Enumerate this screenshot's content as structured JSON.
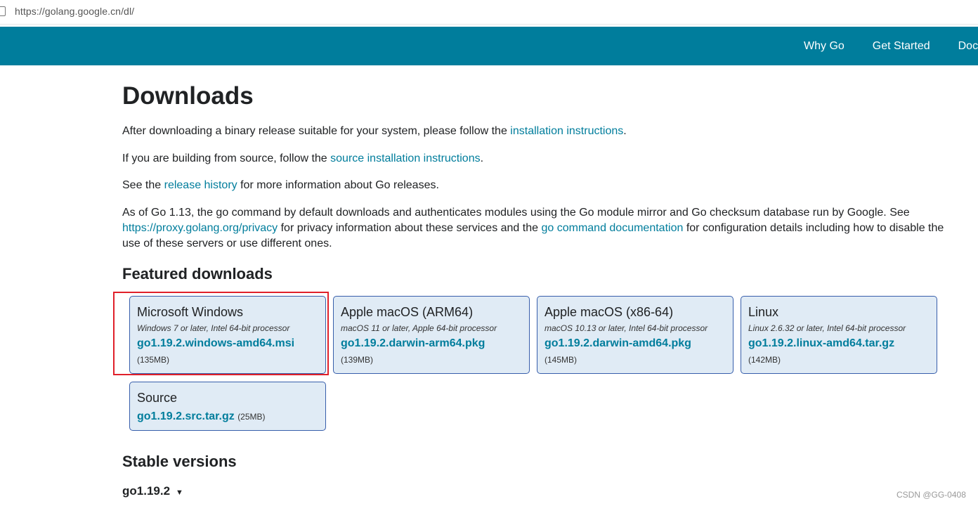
{
  "browser": {
    "url": "https://golang.google.cn/dl/"
  },
  "header": {
    "nav": [
      "Why Go",
      "Get Started",
      "Docs"
    ],
    "color": "#007d9c"
  },
  "page": {
    "title": "Downloads",
    "p1": {
      "before": "After downloading a binary release suitable for your system, please follow the ",
      "link": "installation instructions",
      "after": "."
    },
    "p2": {
      "before": "If you are building from source, follow the ",
      "link": "source installation instructions",
      "after": "."
    },
    "p3": {
      "before": "See the ",
      "link": "release history",
      "after": " for more information about Go releases."
    },
    "p4": {
      "a": "As of Go 1.13, the go command by default downloads and authenticates modules using the Go module mirror and Go checksum database run by Google. See ",
      "link1": "https://proxy.golang.org/privacy",
      "b": " for privacy information about these services and the ",
      "link2": "go command documentation",
      "c": " for configuration details including how to disable the use of these servers or use different ones."
    },
    "featured_heading": "Featured downloads",
    "stable_heading": "Stable versions",
    "stable_version": "go1.19.2",
    "stable_caret": "▼"
  },
  "featured": [
    {
      "os": "Microsoft Windows",
      "req": "Windows 7 or later, Intel 64-bit processor",
      "file": "go1.19.2.windows-amd64.msi",
      "size": "(135MB)"
    },
    {
      "os": "Apple macOS (ARM64)",
      "req": "macOS 11 or later, Apple 64-bit processor",
      "file": "go1.19.2.darwin-arm64.pkg",
      "size": "(139MB)"
    },
    {
      "os": "Apple macOS (x86-64)",
      "req": "macOS 10.13 or later, Intel 64-bit processor",
      "file": "go1.19.2.darwin-amd64.pkg",
      "size": "(145MB)"
    },
    {
      "os": "Linux",
      "req": "Linux 2.6.32 or later, Intel 64-bit processor",
      "file": "go1.19.2.linux-amd64.tar.gz",
      "size": "(142MB)"
    },
    {
      "os": "Source",
      "file": "go1.19.2.src.tar.gz",
      "size": "(25MB)"
    }
  ],
  "watermark": "CSDN @GG-0408",
  "colors": {
    "card_bg": "#e0ebf5",
    "card_border": "#375eab",
    "link": "#007d9c",
    "highlight": "#e0202a"
  }
}
